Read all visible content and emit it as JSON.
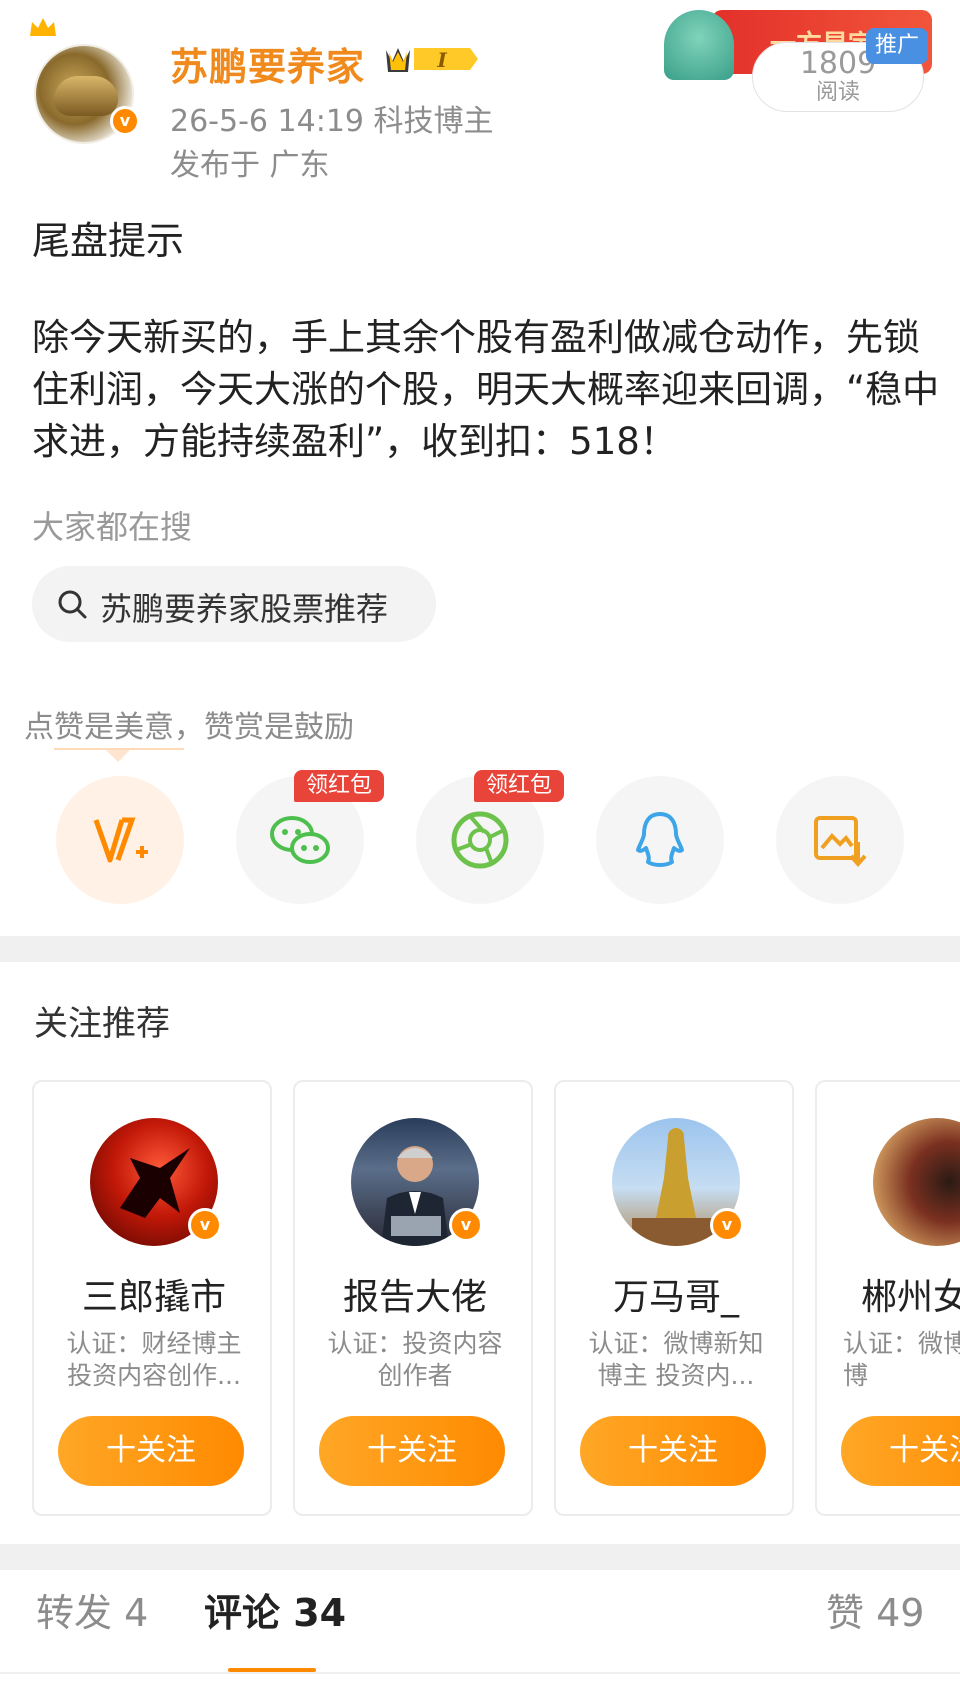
{
  "post": {
    "author": "苏鹏要养家",
    "level": "I",
    "meta": "26-5-6 14:19  科技博主",
    "location": "发布于 广东",
    "title": "尾盘提示",
    "body": "除今天新买的，手上其余个股有盈利做减仓动作，先锁住利润，今天大涨的个股，明天大概率迎来回调，“稳中求进，方能持续盈利”，收到扣：518！"
  },
  "promo": {
    "banner_text": "一方星宇",
    "read_count": "1809",
    "read_label": "阅读",
    "ad_tag": "推广"
  },
  "search": {
    "label": "大家都在搜",
    "chip_text": "苏鹏要养家股票推荐"
  },
  "reward": {
    "hint": "点赞是美意，赞赏是鼓励"
  },
  "share": {
    "red_packet_label": "领红包",
    "buttons": [
      "reward-v-plus",
      "wechat",
      "moments",
      "qq",
      "save-image"
    ]
  },
  "recommend": {
    "title": "关注推荐",
    "follow_label": "十关注",
    "cards": [
      {
        "name": "三郎撬市",
        "desc": "认证：财经博主 投资内容创作..."
      },
      {
        "name": "报告大佬",
        "desc": "认证：投资内容 创作者"
      },
      {
        "name": "万马哥_",
        "desc": "认证：微博新知 博主 投资内..."
      },
      {
        "name": "郴州女",
        "desc": "认证：微博 视频博"
      }
    ]
  },
  "tabs": {
    "repost": "转发 4",
    "comments": "评论 34",
    "likes": "赞 49"
  },
  "colors": {
    "accent": "#ff8a00",
    "author_name": "#f08a1c",
    "muted": "#8c8c8c",
    "red_tag": "#e8443a"
  }
}
